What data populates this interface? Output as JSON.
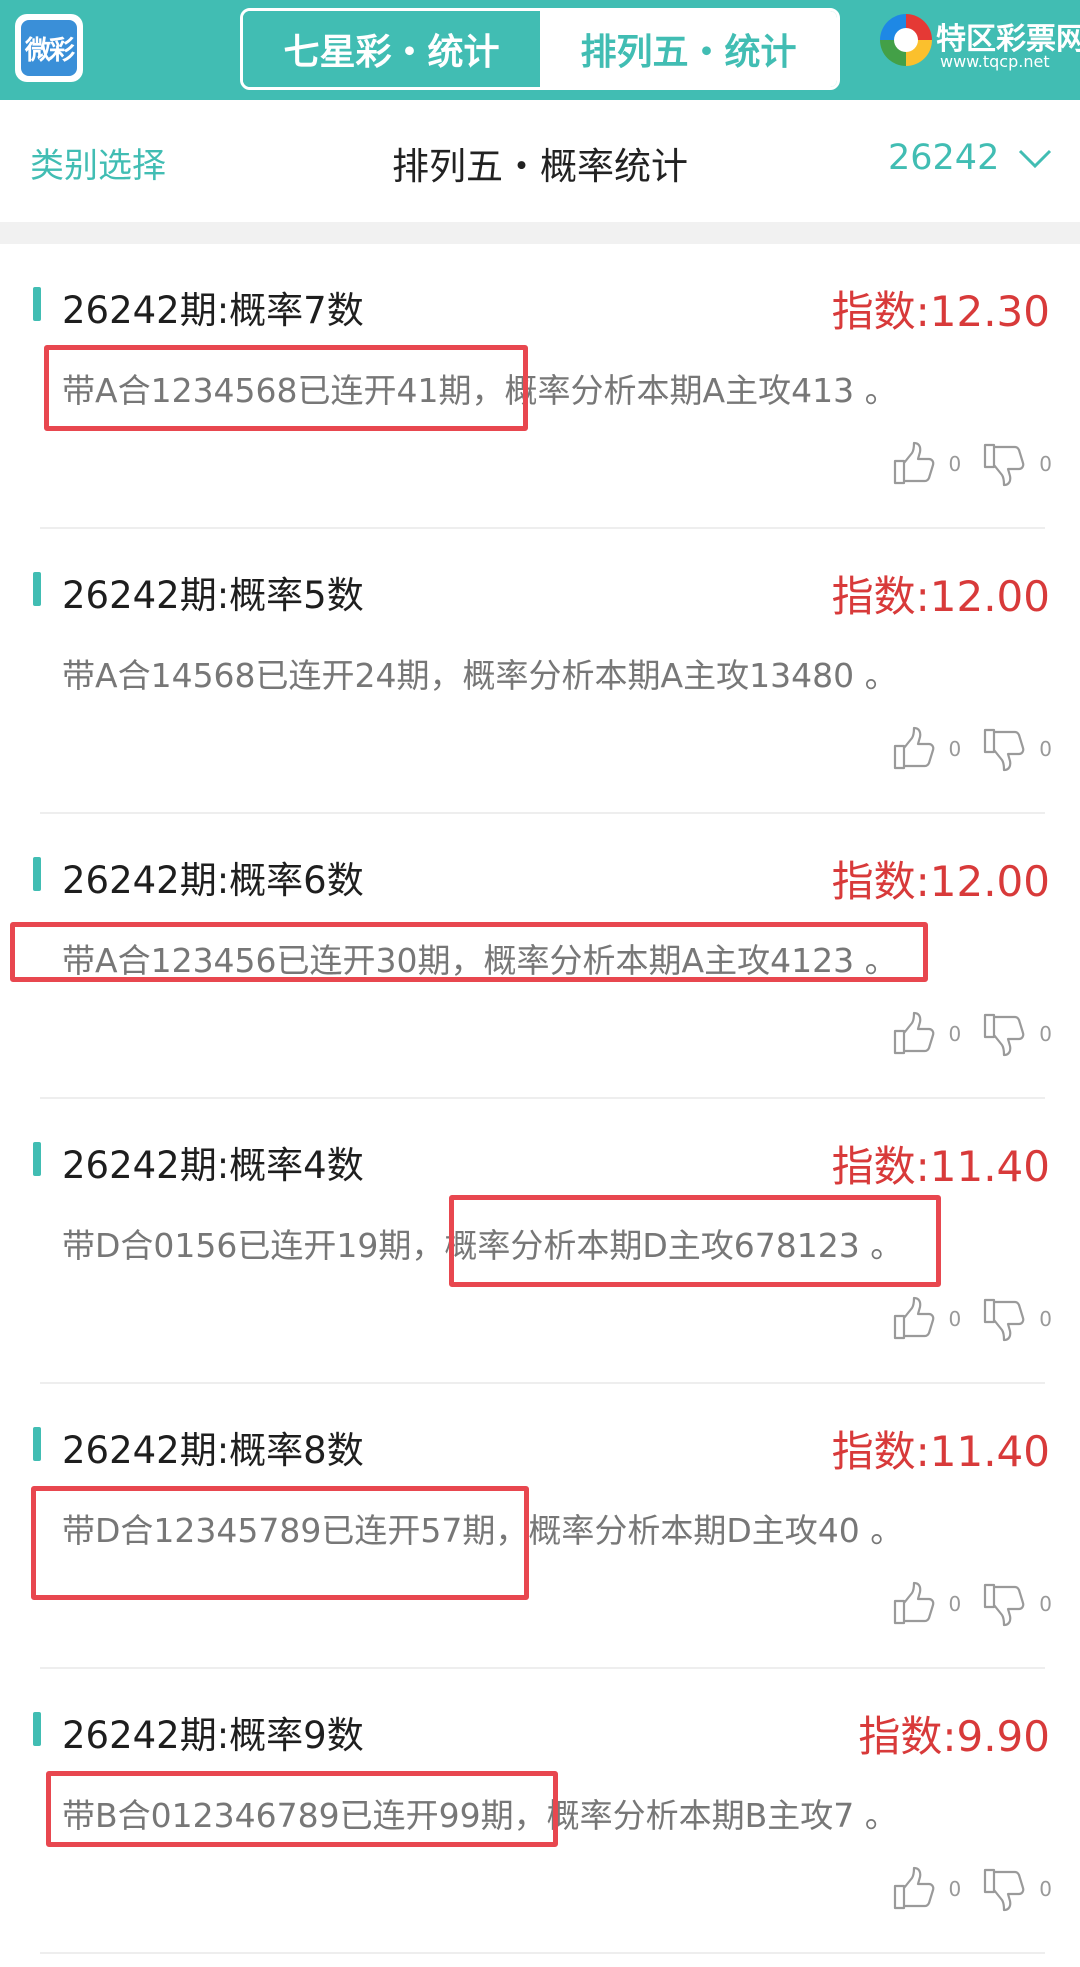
{
  "header": {
    "logo_text": "微彩",
    "tabs": [
      {
        "label": "七星彩・统计",
        "active": false
      },
      {
        "label": "排列五・统计",
        "active": true
      }
    ],
    "brand": {
      "name": "特区彩票网",
      "url": "www.tqcp.net"
    }
  },
  "subheader": {
    "category_select": "类别选择",
    "title": "排列五・概率统计",
    "period": "26242"
  },
  "items": [
    {
      "title": "26242期:概率7数",
      "index": "指数:12.30",
      "text": "带A合1234568已连开41期，概率分析本期A主攻413 。",
      "likes": "0",
      "dislikes": "0"
    },
    {
      "title": "26242期:概率5数",
      "index": "指数:12.00",
      "text": "带A合14568已连开24期，概率分析本期A主攻13480 。",
      "likes": "0",
      "dislikes": "0"
    },
    {
      "title": "26242期:概率6数",
      "index": "指数:12.00",
      "text": "带A合123456已连开30期，概率分析本期A主攻4123 。",
      "likes": "0",
      "dislikes": "0"
    },
    {
      "title": "26242期:概率4数",
      "index": "指数:11.40",
      "text": "带D合0156已连开19期，概率分析本期D主攻678123 。",
      "likes": "0",
      "dislikes": "0"
    },
    {
      "title": "26242期:概率8数",
      "index": "指数:11.40",
      "text": "带D合12345789已连开57期，概率分析本期D主攻40 。",
      "likes": "0",
      "dislikes": "0"
    },
    {
      "title": "26242期:概率9数",
      "index": "指数:9.90",
      "text": "带B合012346789已连开99期，概率分析本期B主攻7 。",
      "likes": "0",
      "dislikes": "0"
    }
  ],
  "colors": {
    "accent": "#41bdb3",
    "index_red": "#d83a3a",
    "highlight": "#e8474f"
  }
}
